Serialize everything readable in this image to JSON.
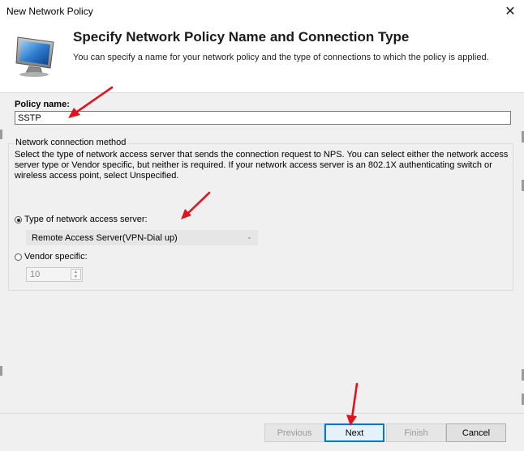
{
  "window": {
    "title": "New Network Policy",
    "close_symbol": "✕"
  },
  "header": {
    "title": "Specify Network Policy Name and Connection Type",
    "subtitle": "You can specify a name for your network policy and the type of connections to which the policy is applied."
  },
  "policy": {
    "label": "Policy name:",
    "value": "SSTP"
  },
  "connection_method": {
    "legend": "Network connection method",
    "description": "Select the type of network access server that sends the connection request to NPS. You can select either the network access server type or Vendor specific, but neither is required.  If your network access server is an 802.1X authenticating switch or wireless access point, select Unspecified.",
    "type_option": {
      "label": "Type of network access server:",
      "selected": true,
      "value": "Remote Access Server(VPN-Dial up)"
    },
    "vendor_option": {
      "label": "Vendor specific:",
      "selected": false,
      "value": "10"
    }
  },
  "buttons": {
    "previous": "Previous",
    "next": "Next",
    "finish": "Finish",
    "cancel": "Cancel"
  },
  "annotation_color": "#e0141e",
  "icons": [
    "computer-monitor-icon",
    "close-icon",
    "dropdown-chevron-icon",
    "spin-up-icon",
    "spin-down-icon"
  ]
}
